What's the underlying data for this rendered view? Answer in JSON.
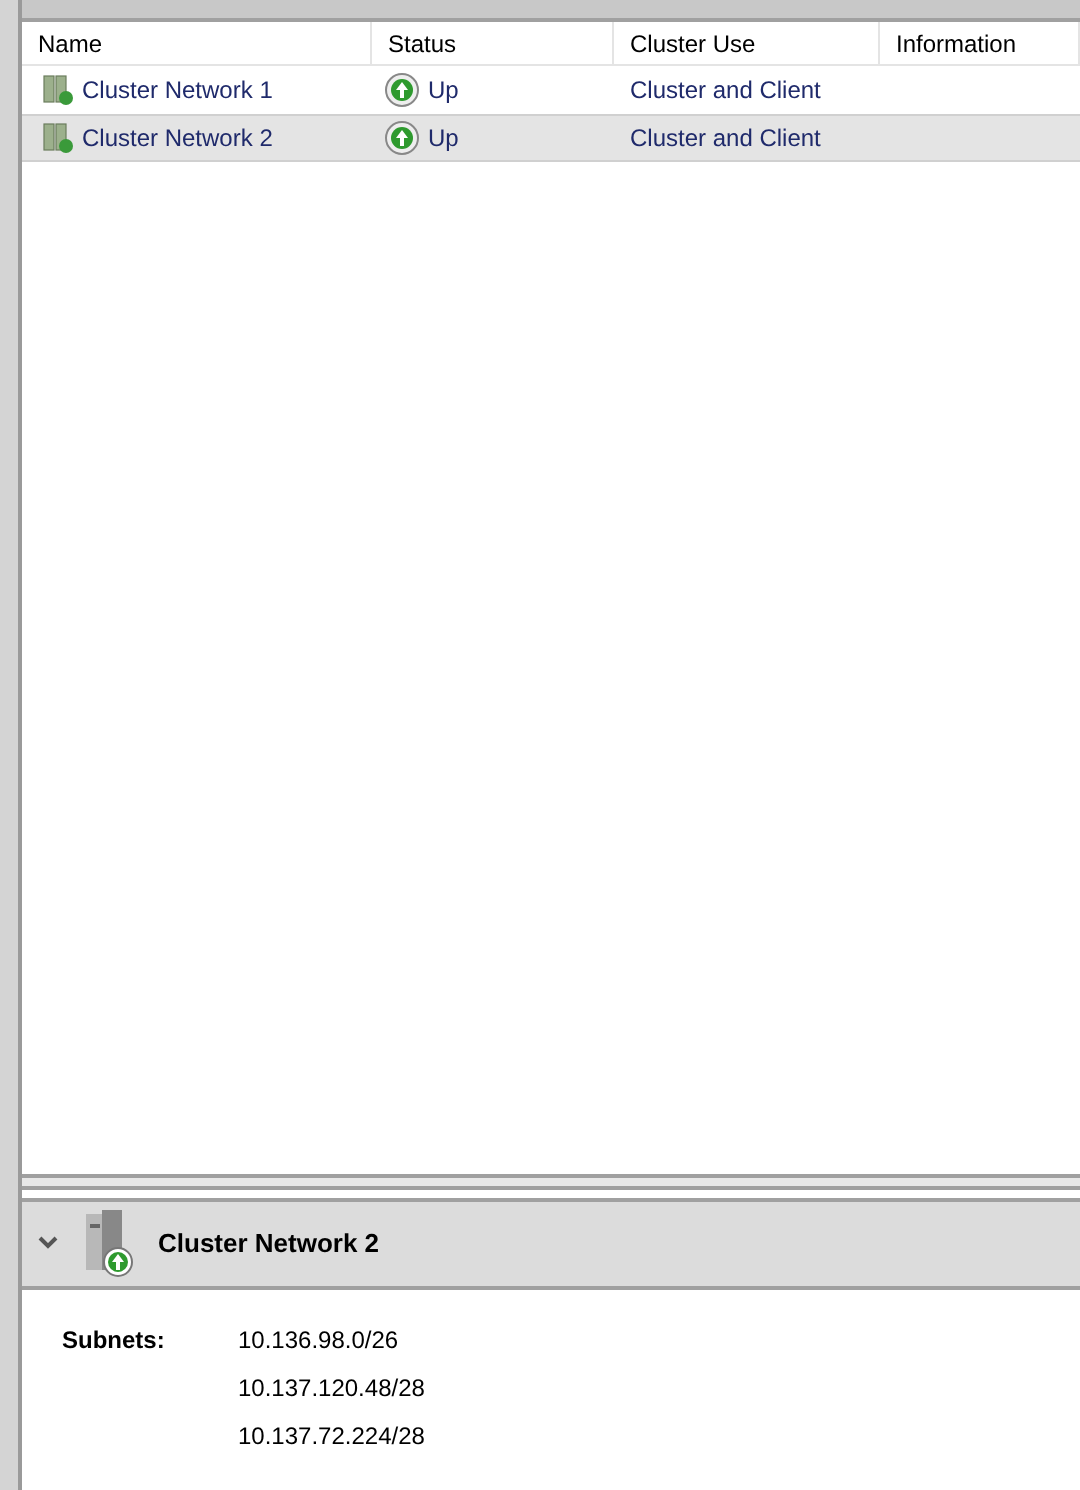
{
  "table": {
    "columns": [
      "Name",
      "Status",
      "Cluster Use",
      "Information"
    ],
    "rows": [
      {
        "name": "Cluster Network 1",
        "status": "Up",
        "cluster_use": "Cluster and Client",
        "selected": false
      },
      {
        "name": "Cluster Network 2",
        "status": "Up",
        "cluster_use": "Cluster and Client",
        "selected": true
      }
    ]
  },
  "details": {
    "title": "Cluster Network 2",
    "expanded": true,
    "label": "Subnets:",
    "subnets": [
      "10.136.98.0/26",
      "10.137.120.48/28",
      "10.137.72.224/28"
    ]
  }
}
